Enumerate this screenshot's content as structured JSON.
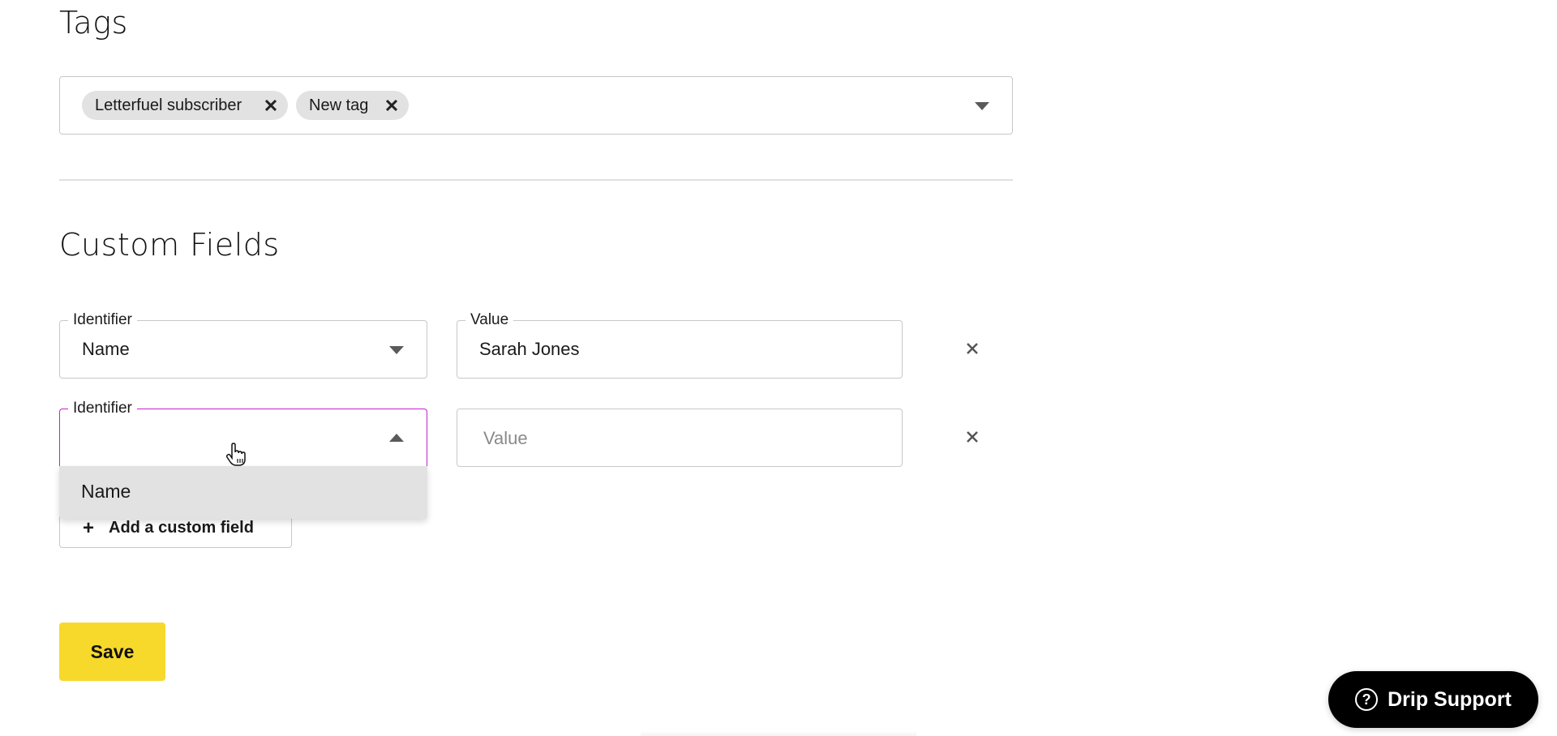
{
  "tags": {
    "heading": "Tags",
    "chips": [
      {
        "label": "Letterfuel subscriber"
      },
      {
        "label": "New tag"
      }
    ]
  },
  "custom_fields": {
    "heading": "Custom Fields",
    "rows": [
      {
        "identifier_label": "Identifier",
        "identifier_value": "Name",
        "value_label": "Value",
        "value": "Sarah Jones"
      },
      {
        "identifier_label": "Identifier",
        "identifier_value": "",
        "value_placeholder": "Value"
      }
    ],
    "dropdown_options": [
      "Name"
    ],
    "add_label": "Add a custom field",
    "add_icon": "+"
  },
  "save_label": "Save",
  "support": {
    "label": "Drip Support",
    "icon": "?"
  },
  "colors": {
    "accent_focus": "#c51fd3",
    "save": "#f7d92b"
  }
}
